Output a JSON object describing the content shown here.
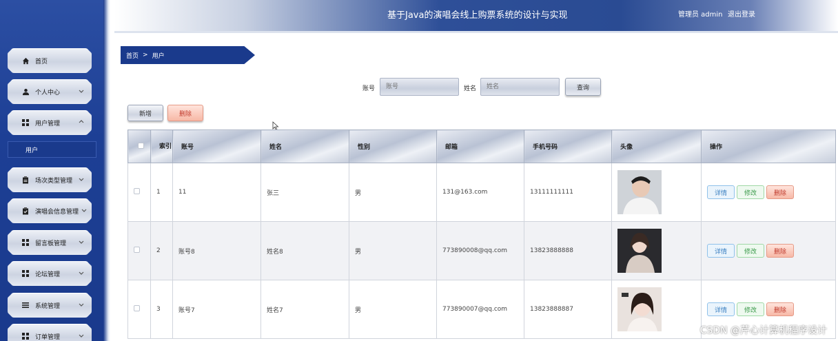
{
  "header": {
    "title": "基于Java的演唱会线上购票系统的设计与实现",
    "user_label": "管理员 admin",
    "logout": "退出登录"
  },
  "sidebar": {
    "items": [
      {
        "label": "首页",
        "icon": "home-icon"
      },
      {
        "label": "个人中心",
        "icon": "user-icon"
      },
      {
        "label": "用户管理",
        "icon": "grid-icon"
      },
      {
        "label": "场次类型管理",
        "icon": "clipboard-icon"
      },
      {
        "label": "演唱会信息管理",
        "icon": "clipboard-check-icon"
      },
      {
        "label": "留言板管理",
        "icon": "grid-icon"
      },
      {
        "label": "论坛管理",
        "icon": "grid-icon"
      },
      {
        "label": "系统管理",
        "icon": "list-icon"
      },
      {
        "label": "订单管理",
        "icon": "grid-icon"
      }
    ],
    "submenu_active": "用户"
  },
  "breadcrumb": {
    "home": "首页",
    "sep": ">",
    "current": "用户"
  },
  "search": {
    "account_label": "账号",
    "account_placeholder": "账号",
    "name_label": "姓名",
    "name_placeholder": "姓名",
    "query_button": "查询"
  },
  "toolbar": {
    "add": "新增",
    "delete": "删除"
  },
  "table": {
    "headers": [
      "",
      "索引",
      "账号",
      "姓名",
      "性别",
      "邮箱",
      "手机号码",
      "头像",
      "操作"
    ],
    "rows": [
      {
        "index": "1",
        "account": "11",
        "name": "张三",
        "gender": "男",
        "email": "131@163.com",
        "phone": "13111111111"
      },
      {
        "index": "2",
        "account": "账号8",
        "name": "姓名8",
        "gender": "男",
        "email": "773890008@qq.com",
        "phone": "13823888888"
      },
      {
        "index": "3",
        "account": "账号7",
        "name": "姓名7",
        "gender": "男",
        "email": "773890007@qq.com",
        "phone": "13823888887"
      }
    ],
    "actions": {
      "detail": "详情",
      "edit": "修改",
      "delete": "删除"
    }
  },
  "watermark": "CSDN @芹心计算机程序设计",
  "colors": {
    "primary": "#1a3a8c",
    "danger": "#c0392b"
  }
}
